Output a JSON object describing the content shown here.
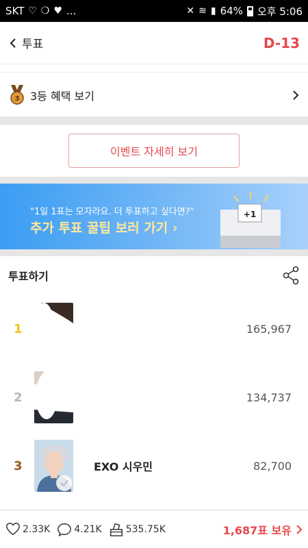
{
  "status_bar": {
    "carrier": "SKT",
    "battery": "64%",
    "time": "오후 5:06",
    "dots": "..."
  },
  "header": {
    "back_label": "투표",
    "dday": "D-13"
  },
  "benefit": {
    "label": "3등 혜택 보기"
  },
  "event": {
    "button_label": "이벤트 자세히 보기"
  },
  "banner": {
    "subtitle": "\"1일 1표는 모자라요. 더 투표하고 싶다면?\"",
    "title": "추가 투표 꿀팁 보러 가기",
    "badge": "+1"
  },
  "vote": {
    "title": "투표하기",
    "rankings": [
      {
        "rank": "1",
        "name": "",
        "votes": "165,967",
        "rank_color": "#f2c316"
      },
      {
        "rank": "2",
        "name": "",
        "votes": "134,737",
        "rank_color": "#b8b8b8"
      },
      {
        "rank": "3",
        "name": "EXO 시우민",
        "votes": "82,700",
        "rank_color": "#9c5a1e"
      }
    ]
  },
  "bottom_bar": {
    "likes": "2.33K",
    "comments": "4.21K",
    "votes": "535.75K",
    "owned": "1,687표 보유"
  },
  "colors": {
    "accent": "#e5484d",
    "banner_start": "#3a9df3",
    "banner_end": "#a7d1fb"
  }
}
